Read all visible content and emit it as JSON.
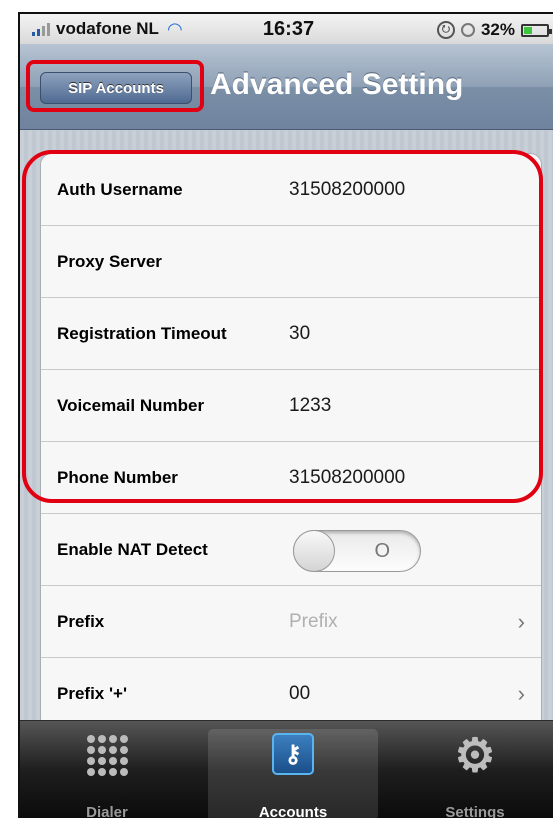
{
  "status_bar": {
    "carrier": "vodafone NL",
    "time": "16:37",
    "battery": "32%",
    "battery_level": 0.32
  },
  "nav": {
    "back_label": "SIP Accounts",
    "title": "Advanced Setting"
  },
  "settings": {
    "rows": [
      {
        "label": "Auth Username",
        "value": "31508200000"
      },
      {
        "label": "Proxy Server",
        "value": ""
      },
      {
        "label": "Registration Timeout",
        "value": "30"
      },
      {
        "label": "Voicemail Number",
        "value": "1233"
      },
      {
        "label": "Phone Number",
        "value": "31508200000"
      }
    ],
    "nat_detect": {
      "label": "Enable NAT Detect",
      "state": "O"
    },
    "prefix": {
      "label": "Prefix",
      "placeholder": "Prefix"
    },
    "prefix_plus": {
      "label": "Prefix '+'",
      "value": "00"
    }
  },
  "tabs": [
    {
      "label": "Dialer",
      "icon": "dialer-grid-icon"
    },
    {
      "label": "Accounts",
      "icon": "key-icon"
    },
    {
      "label": "Settings",
      "icon": "gear-icon"
    }
  ],
  "colors": {
    "highlight": "#e00012",
    "nav_bar": "#7b8fa6",
    "tab_bar": "#0a0a0a"
  }
}
